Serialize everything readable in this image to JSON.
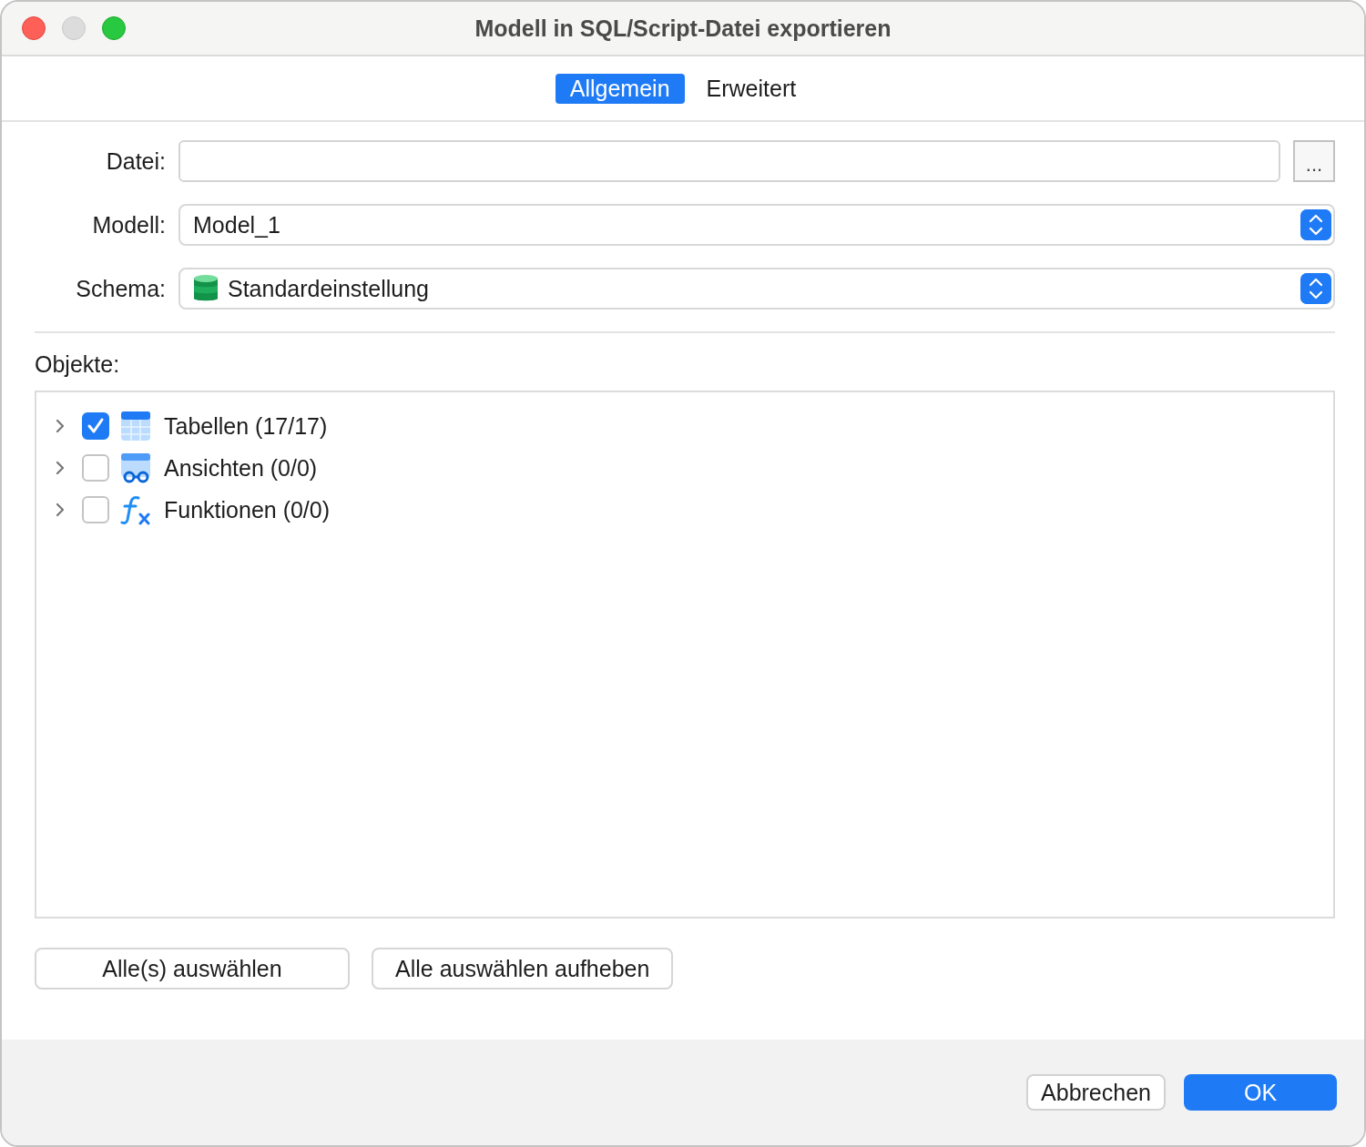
{
  "window": {
    "title": "Modell in SQL/Script-Datei exportieren"
  },
  "tabs": [
    {
      "label": "Allgemein",
      "selected": true
    },
    {
      "label": "Erweitert",
      "selected": false
    }
  ],
  "file": {
    "label": "Datei:",
    "browse": "..."
  },
  "model": {
    "label": "Modell:",
    "value": "Model_1"
  },
  "schema": {
    "label": "Schema:",
    "value": "Standardeinstellung"
  },
  "objects": {
    "label": "Objekte:",
    "items": [
      {
        "kind": "table",
        "label": "Tabellen (17/17)",
        "checked": true,
        "expanded": false
      },
      {
        "kind": "view",
        "label": "Ansichten (0/0)",
        "checked": false,
        "expanded": false
      },
      {
        "kind": "function",
        "label": "Funktionen (0/0)",
        "checked": false,
        "expanded": false
      }
    ]
  },
  "selection_buttons": [
    "Alle(s) auswählen",
    "Alle auswählen aufheben"
  ],
  "footer_buttons": [
    {
      "label": "Abbrechen",
      "kind": "secondary"
    },
    {
      "label": "OK",
      "kind": "primary"
    }
  ]
}
